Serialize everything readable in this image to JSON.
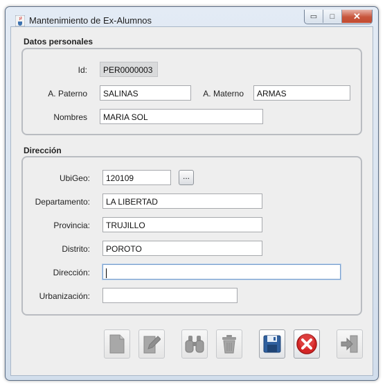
{
  "window": {
    "title": "Mantenimiento de Ex-Alumnos",
    "controls": {
      "minimize": "▭",
      "maximize": "□",
      "close": "✕"
    }
  },
  "personal": {
    "section_title": "Datos personales",
    "id_label": "Id:",
    "id_value": "PER0000003",
    "paterno_label": "A. Paterno",
    "paterno_value": "SALINAS",
    "materno_label": "A. Materno",
    "materno_value": "ARMAS",
    "nombres_label": "Nombres",
    "nombres_value": "MARIA SOL"
  },
  "direccion_section": {
    "section_title": "Dirección",
    "ubigeo_label": "UbiGeo:",
    "ubigeo_value": "120109",
    "ubigeo_button": "...",
    "departamento_label": "Departamento:",
    "departamento_value": "LA LIBERTAD",
    "provincia_label": "Provincia:",
    "provincia_value": "TRUJILLO",
    "distrito_label": "Distrito:",
    "distrito_value": "POROTO",
    "direccion_label": "Dirección:",
    "direccion_value": "",
    "urbanizacion_label": "Urbanización:",
    "urbanizacion_value": ""
  },
  "toolbar": {
    "buttons": [
      {
        "icon": "new-document-icon",
        "enabled": false
      },
      {
        "icon": "edit-pencil-icon",
        "enabled": false
      },
      {
        "icon": "binoculars-search-icon",
        "enabled": false
      },
      {
        "icon": "trash-can-icon",
        "enabled": false
      },
      {
        "icon": "floppy-save-icon",
        "enabled": true
      },
      {
        "icon": "cancel-x-icon",
        "enabled": true
      },
      {
        "icon": "exit-door-icon",
        "enabled": false
      }
    ]
  },
  "colors": {
    "save_blue": "#2f5f9e",
    "cancel_red": "#d42626",
    "disabled_gray": "#9a9a9a"
  }
}
